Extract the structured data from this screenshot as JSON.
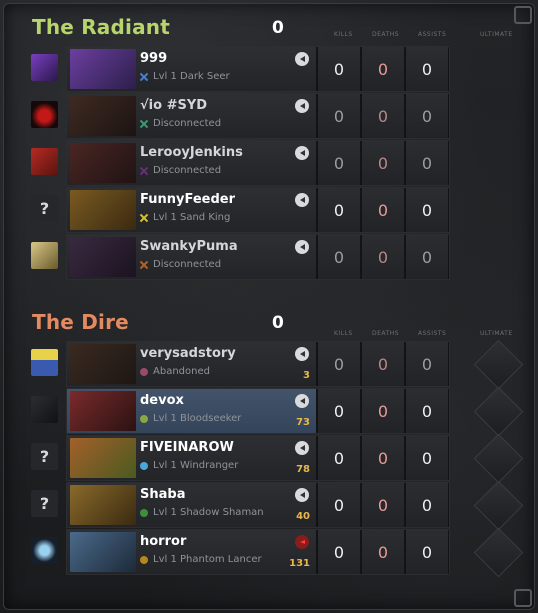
{
  "headers": {
    "kills": "KILLS",
    "deaths": "DEATHS",
    "assists": "ASSISTS",
    "ultimate": "ULTIMATE"
  },
  "radiant": {
    "title": "The Radiant",
    "score": "0",
    "color": "#b7d56b",
    "players": [
      {
        "name": "999",
        "status": "Lvl 1 Dark Seer",
        "status_color": "#4c7fd1",
        "mark": "x",
        "kills": "0",
        "deaths": "0",
        "assists": "0",
        "avatar": "purple-hero-avatar",
        "portrait_colors": [
          "#6b3fa0",
          "#2c1f4a"
        ],
        "voice": "mic-icon"
      },
      {
        "name": "√io #SYD",
        "status": "Disconnected",
        "status_color": "#3d9a73",
        "mark": "x",
        "kills": "0",
        "deaths": "0",
        "assists": "0",
        "avatar": "red-demon-avatar",
        "portrait_colors": [
          "#3f2a22",
          "#1c1412"
        ],
        "voice": "mic-icon"
      },
      {
        "name": "LerooyJenkins",
        "status": "Disconnected",
        "status_color": "#6a2f7a",
        "mark": "x",
        "kills": "0",
        "deaths": "0",
        "assists": "0",
        "avatar": "red-badge-avatar",
        "portrait_colors": [
          "#4a2622",
          "#201314"
        ],
        "voice": "mic-icon"
      },
      {
        "name": "FunnyFeeder",
        "status": "Lvl 1 Sand King",
        "status_color": "#d8c12d",
        "mark": "x",
        "kills": "0",
        "deaths": "0",
        "assists": "0",
        "avatar": "unknown",
        "portrait_colors": [
          "#7a5a22",
          "#3a2a10"
        ],
        "voice": "mic-icon"
      },
      {
        "name": "SwankyPuma",
        "status": "Disconnected",
        "status_color": "#b6632a",
        "mark": "x",
        "kills": "0",
        "deaths": "0",
        "assists": "0",
        "avatar": "skull-avatar",
        "portrait_colors": [
          "#3a2a40",
          "#1a1320"
        ],
        "voice": "mic-icon"
      }
    ]
  },
  "dire": {
    "title": "The Dire",
    "score": "0",
    "color": "#e28b62",
    "players": [
      {
        "name": "verysadstory",
        "status": "Abandoned",
        "status_color": "#9a4a6a",
        "mark": "dot",
        "gold": "3",
        "kills": "0",
        "deaths": "0",
        "assists": "0",
        "avatar": "yellow-logo-avatar",
        "portrait_colors": [
          "#3a2a20",
          "#1d1714"
        ],
        "voice": "mic-icon"
      },
      {
        "name": "devox",
        "status": "Lvl 1 Bloodseeker",
        "status_color": "#88a845",
        "mark": "dot",
        "gold": "73",
        "kills": "0",
        "deaths": "0",
        "assists": "0",
        "avatar": "dark-portrait-avatar",
        "portrait_colors": [
          "#7a2a2a",
          "#2a1212"
        ],
        "voice": "mic-icon"
      },
      {
        "name": "FIVEINAROW",
        "status": "Lvl 1 Windranger",
        "status_color": "#4aa7d8",
        "mark": "dot",
        "gold": "78",
        "kills": "0",
        "deaths": "0",
        "assists": "0",
        "avatar": "unknown",
        "portrait_colors": [
          "#a4602a",
          "#4a5a20"
        ],
        "voice": "mic-icon"
      },
      {
        "name": "Shaba",
        "status": "Lvl 1 Shadow Shaman",
        "status_color": "#3f8f3a",
        "mark": "dot",
        "gold": "40",
        "kills": "0",
        "deaths": "0",
        "assists": "0",
        "avatar": "unknown",
        "portrait_colors": [
          "#8a6a2a",
          "#3a2a12"
        ],
        "voice": "mic-icon"
      },
      {
        "name": "horror",
        "status": "Lvl 1 Phantom Lancer",
        "status_color": "#b8861e",
        "mark": "dot",
        "gold": "131",
        "kills": "0",
        "deaths": "0",
        "assists": "0",
        "avatar": "blue-mask-avatar",
        "portrait_colors": [
          "#4a6a8a",
          "#1d2a3a"
        ],
        "voice": "record-icon"
      }
    ]
  },
  "highlighted_player": "devox",
  "unknown_avatar_glyph": "?"
}
